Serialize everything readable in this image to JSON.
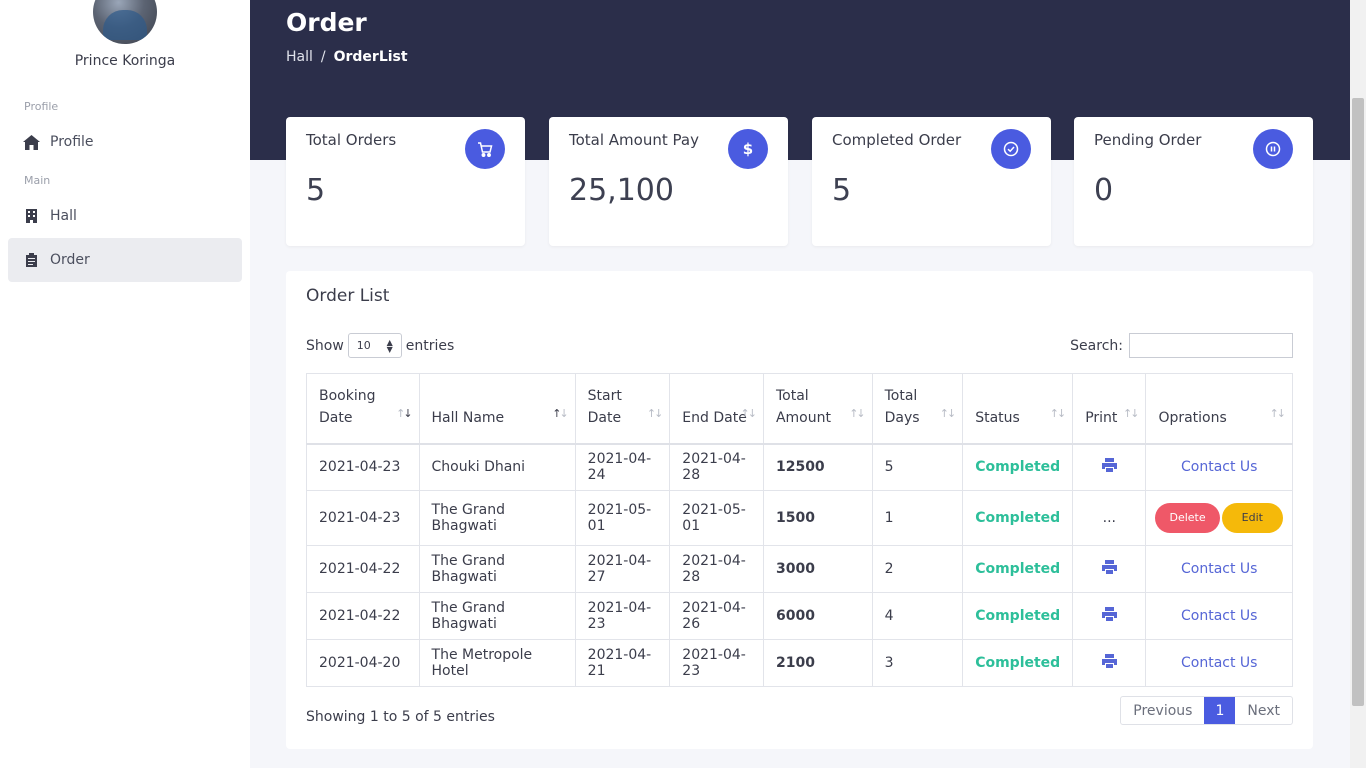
{
  "sidebar": {
    "username": "Prince Koringa",
    "sections": {
      "profile": "Profile",
      "main": "Main"
    },
    "items": [
      {
        "label": "Profile",
        "icon": "home-icon"
      },
      {
        "label": "Hall",
        "icon": "building-icon"
      },
      {
        "label": "Order",
        "icon": "clipboard-icon"
      }
    ]
  },
  "header": {
    "title": "Order",
    "breadcrumb": {
      "parent": "Hall",
      "separator": "/",
      "current": "OrderList"
    }
  },
  "stats": [
    {
      "label": "Total Orders",
      "value": "5",
      "icon": "cart-icon"
    },
    {
      "label": "Total Amount Pay",
      "value": "25,100",
      "icon": "dollar-icon"
    },
    {
      "label": "Completed Order",
      "value": "5",
      "icon": "check-circle-icon"
    },
    {
      "label": "Pending Order",
      "value": "0",
      "icon": "pause-icon"
    }
  ],
  "order_list": {
    "title": "Order List",
    "show_label": "Show",
    "entries_value": "10",
    "entries_label": "entries",
    "search_label": "Search:",
    "columns": [
      "Booking Date",
      "Hall Name",
      "Start Date",
      "End Date",
      "Total Amount",
      "Total Days",
      "Status",
      "Print",
      "Oprations"
    ],
    "rows": [
      {
        "booking": "2021-04-23",
        "hall": "Chouki Dhani",
        "start": "2021-04-24",
        "end": "2021-04-28",
        "amount": "12500",
        "days": "5",
        "status": "Completed",
        "print": "print-icon",
        "op": "Contact Us"
      },
      {
        "booking": "2021-04-23",
        "hall": "The Grand Bhagwati",
        "start": "2021-05-01",
        "end": "2021-05-01",
        "amount": "1500",
        "days": "1",
        "status": "Completed",
        "print": "...",
        "delete": "Delete",
        "edit": "Edit"
      },
      {
        "booking": "2021-04-22",
        "hall": "The Grand Bhagwati",
        "start": "2021-04-27",
        "end": "2021-04-28",
        "amount": "3000",
        "days": "2",
        "status": "Completed",
        "print": "print-icon",
        "op": "Contact Us"
      },
      {
        "booking": "2021-04-22",
        "hall": "The Grand Bhagwati",
        "start": "2021-04-23",
        "end": "2021-04-26",
        "amount": "6000",
        "days": "4",
        "status": "Completed",
        "print": "print-icon",
        "op": "Contact Us"
      },
      {
        "booking": "2021-04-20",
        "hall": "The Metropole Hotel",
        "start": "2021-04-21",
        "end": "2021-04-23",
        "amount": "2100",
        "days": "3",
        "status": "Completed",
        "print": "print-icon",
        "op": "Contact Us"
      }
    ],
    "info": "Showing 1 to 5 of 5 entries",
    "pagination": {
      "previous": "Previous",
      "page": "1",
      "next": "Next"
    }
  },
  "colors": {
    "header_bg": "#2b2e4a",
    "accent": "#4a5be0",
    "status_green": "#2dbf9a",
    "delete_red": "#ef5868",
    "edit_yellow": "#f5b90a"
  }
}
